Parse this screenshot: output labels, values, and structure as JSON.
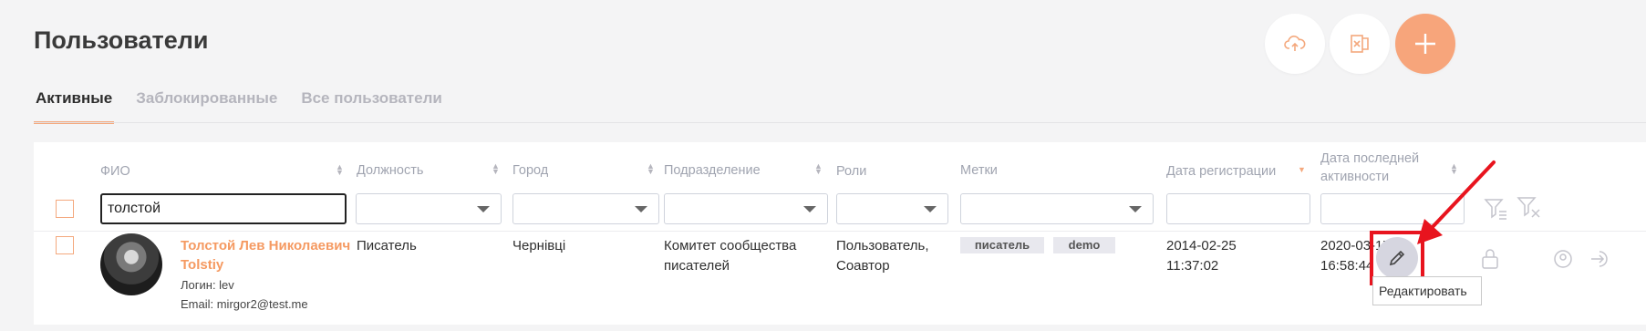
{
  "page": {
    "title": "Пользователи"
  },
  "top_buttons": {
    "upload_icon": "cloud-upload-icon",
    "excel_icon": "excel-export-icon",
    "add_icon": "plus-icon",
    "accent": "#f7a57b"
  },
  "tabs": [
    {
      "label": "Активные",
      "active": true
    },
    {
      "label": "Заблокированные",
      "active": false
    },
    {
      "label": "Все пользователи",
      "active": false
    }
  ],
  "table": {
    "headers": {
      "fio": "ФИО",
      "position": "Должность",
      "city": "Город",
      "department": "Подразделение",
      "roles": "Роли",
      "tags": "Метки",
      "reg_date": "Дата регистрации",
      "last_activity": "Дата последней активности"
    },
    "filters": {
      "fio_value": "толстой"
    },
    "rows": [
      {
        "name": "Толстой Лев Николаевич Tolstiy",
        "login": "Логин: lev",
        "email": "Email: mirgor2@test.me",
        "position": "Писатель",
        "city": "Чернівці",
        "department": "Комитет сообщества писателей",
        "roles": "Пользователь, Соавтор",
        "tags": [
          "писатель",
          "demo"
        ],
        "reg_date": "2014-02-25",
        "reg_time": "11:37:02",
        "last_date": "2020-03-17",
        "last_time": "16:58:44"
      }
    ]
  },
  "tooltip": {
    "text": "Редактировать"
  },
  "colors": {
    "accent": "#f59a62",
    "highlight": "#e8141e"
  }
}
